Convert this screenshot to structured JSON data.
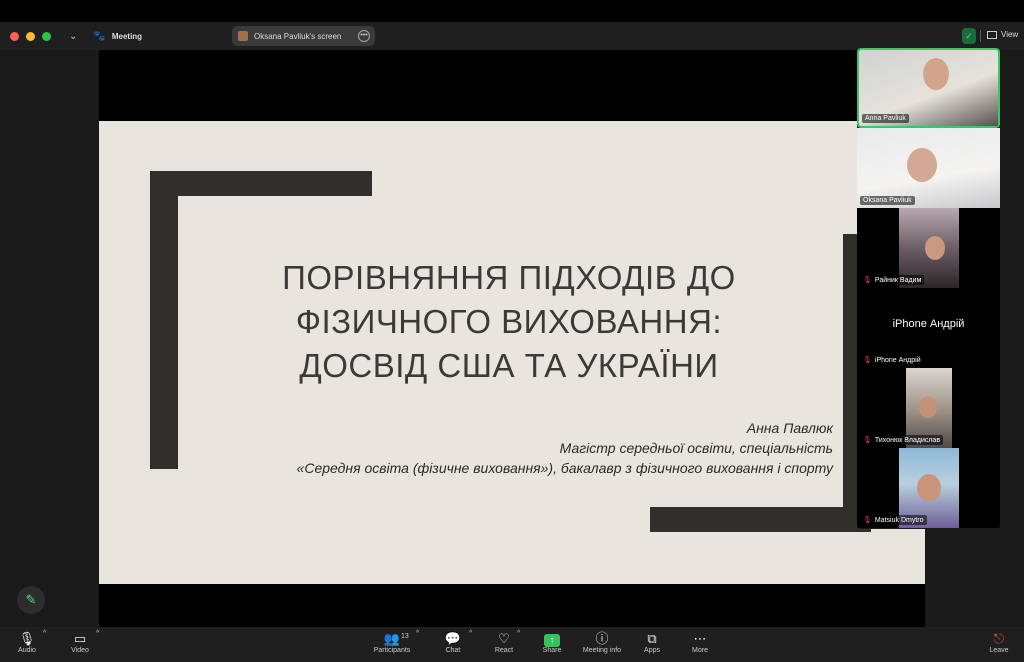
{
  "titlebar": {
    "meeting_label": "Meeting",
    "share_pill_label": "Oksana Pavliuk's screen",
    "view_label": "View"
  },
  "slide": {
    "title": "ПОРІВНЯННЯ ПІДХОДІВ ДО ФІЗИЧНОГО ВИХОВАННЯ: ДОСВІД США ТА УКРАЇНИ",
    "author_name": "Анна Павлюк",
    "author_line1": "Магістр середньої освіти, спеціальність",
    "author_line2": "«Середня освіта (фізичне виховання»), бакалавр з фізичного виховання і спорту"
  },
  "participants": [
    {
      "name": "Anna Pavliuk",
      "muted": false
    },
    {
      "name": "Oksana Pavliuk",
      "muted": false
    },
    {
      "name": "Райник Вадим",
      "muted": true
    },
    {
      "name": "iPhone Андрій",
      "muted": true,
      "display_name": "iPhone Андрій"
    },
    {
      "name": "Тихонюк Владислав",
      "muted": true
    },
    {
      "name": "Matsiuk Dmytro",
      "muted": true
    }
  ],
  "toolbar": {
    "audio": "Audio",
    "video": "Video",
    "participants": "Participants",
    "participants_count": "13",
    "chat": "Chat",
    "react": "React",
    "share": "Share",
    "meeting_info": "Meeting info",
    "apps": "Apps",
    "more": "More",
    "leave": "Leave"
  },
  "colors": {
    "accent_green": "#35c25a",
    "slide_background": "#e8e5de",
    "slide_bars": "#302f2c",
    "mute_red": "#e04848"
  }
}
